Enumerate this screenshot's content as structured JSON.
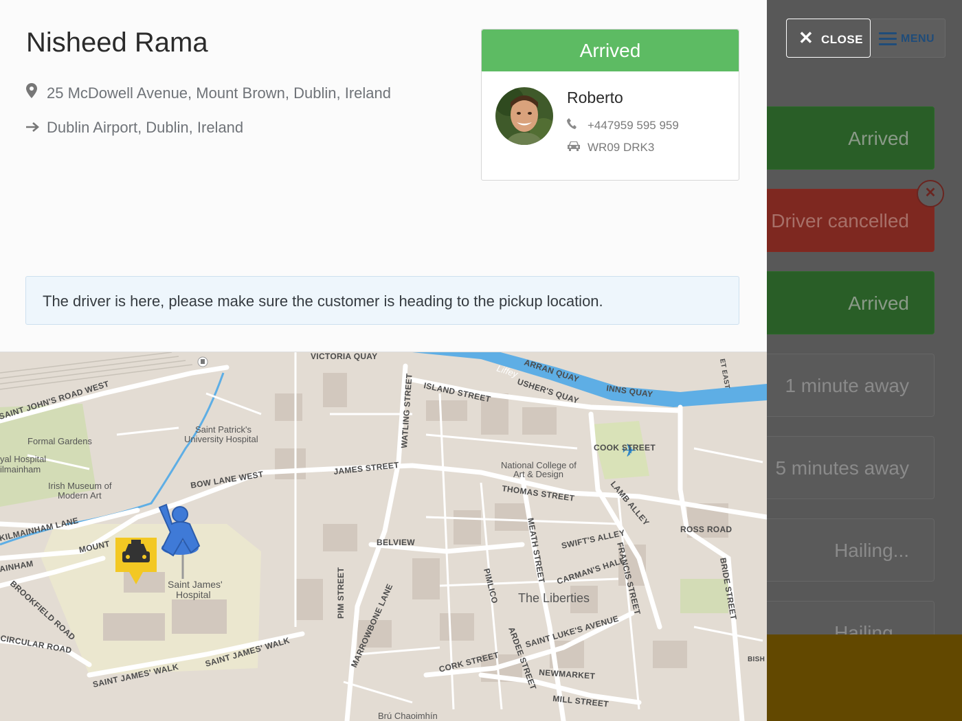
{
  "right_panel": {
    "menu_label": "MENU",
    "job_cards": [
      {
        "label": "Arrived",
        "style": "green"
      },
      {
        "label": "Driver cancelled",
        "style": "red"
      },
      {
        "label": "Arrived",
        "style": "green"
      },
      {
        "label": "1 minute away",
        "style": "grey"
      },
      {
        "label": "5 minutes away",
        "style": "grey"
      },
      {
        "label": "Hailing...",
        "style": "grey"
      },
      {
        "label": "Hailing...",
        "style": "grey"
      }
    ],
    "cancel_icon": "close-circle-icon"
  },
  "close_button": {
    "label": "CLOSE",
    "icon": "close-icon"
  },
  "customer": {
    "name": "Nisheed Rama",
    "pickup": "25 McDowell Avenue, Mount Brown, Dublin, Ireland",
    "dropoff": "Dublin Airport, Dublin, Ireland"
  },
  "driver_card": {
    "status": "Arrived",
    "status_color": "#5dbb63",
    "driver_name": "Roberto",
    "phone": "+447959 595 959",
    "plate": "WR09 DRK3"
  },
  "notice": "The driver is here, please make sure the customer is heading to the pickup location.",
  "map": {
    "labels": {
      "victoria_quay": "VICTORIA QUAY",
      "saint_johns_road": "SAINT JOHN'S ROAD WEST",
      "formal_gardens": "Formal Gardens",
      "royal_hospital_1": "yal Hospital",
      "royal_hospital_2": "ilmainham",
      "irish_museum_1": "Irish Museum of",
      "irish_museum_2": "Modern Art",
      "st_patricks_1": "Saint Patrick's",
      "st_patricks_2": "University Hospital",
      "bow_lane": "BOW LANE WEST",
      "kilmainham_lane": "KILMAINHAM LANE",
      "mount": "MOUNT",
      "ainham": "AINHAM",
      "brookfield": "BROOKFIELD ROAD",
      "circular_road": "CIRCULAR ROAD",
      "st_james_hospital_1": "Saint James'",
      "st_james_hospital_2": "Hospital",
      "st_james_walk_1": "SAINT JAMES' WALK",
      "st_james_walk_2": "SAINT JAMES' WALK",
      "watling": "WATLING STREET",
      "island_street": "ISLAND STREET",
      "james_street": "JAMES STREET",
      "arran_quay": "ARRAN QUAY",
      "ushers_quay": "USHER'S QUAY",
      "inns_quay": "INNS QUAY",
      "liffey": "Liffey",
      "cook_street": "COOK STREET",
      "ncad_1": "National College of",
      "ncad_2": "Art & Design",
      "thomas_street": "THOMAS STREET",
      "lamb_alley": "LAMB ALLEY",
      "ross_road": "ROSS ROAD",
      "belview": "BELVIEW",
      "meath_street": "MEATH STREET",
      "swifts_alley": "SWIFT'S ALLEY",
      "francis_street": "FRANCIS STREET",
      "carmans_hall": "CARMAN'S HALL",
      "pimlico": "PIMLICO",
      "the_liberties": "The Liberties",
      "bride_street": "BRIDE STREET",
      "pim_street": "PIM STREET",
      "marrowbone": "MARROWBONE LANE",
      "ardee": "ARDEE STREET",
      "st_lukes": "SAINT LUKE'S AVENUE",
      "cork_street": "CORK STREET",
      "newmarket": "NEWMARKET",
      "mill_street": "MILL STREET",
      "bru": "Brú Chaoimhín",
      "bish": "BISH",
      "et_east": "ET EAST"
    }
  }
}
